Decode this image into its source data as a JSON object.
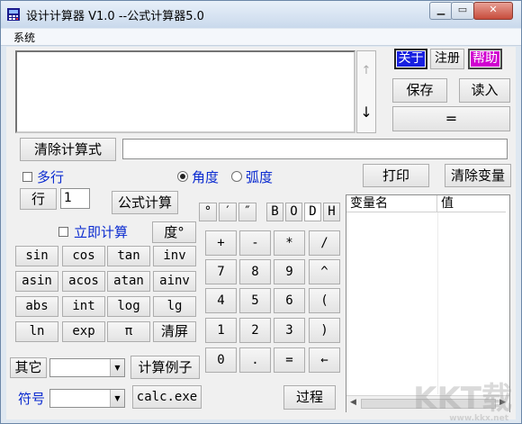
{
  "window": {
    "title": "设计计算器 V1.0 --公式计算器5.0",
    "minimize_icon": "minimize-icon",
    "maximize_icon": "maximize-icon",
    "close_icon": "close-icon"
  },
  "menu": {
    "system": "系统"
  },
  "right_top": {
    "about": "关于",
    "register": "注册",
    "help": "帮助",
    "save": "保存",
    "read": "读入",
    "equals": "=",
    "about_color": "#1820e0",
    "help_color": "#d000d0"
  },
  "formula_bar": {
    "clear_formula": "清除计算式",
    "result_value": ""
  },
  "options": {
    "multiline": "多行",
    "degree": "角度",
    "radian": "弧度",
    "print": "打印",
    "clear_vars": "清除变量",
    "row_label": "行",
    "row_value": "1",
    "formula_calc": "公式计算",
    "instant_calc": "立即计算",
    "degree_symbol_btn": "度°"
  },
  "symbols": {
    "deg": "°",
    "min": "′",
    "sec": "″",
    "b": "B",
    "o": "O",
    "d": "D",
    "h": "H"
  },
  "functions": {
    "sin": "sin",
    "cos": "cos",
    "tan": "tan",
    "inv": "inv",
    "asin": "asin",
    "acos": "acos",
    "atan": "atan",
    "ainv": "ainv",
    "abs": "abs",
    "int": "int",
    "log": "log",
    "lg": "lg",
    "ln": "ln",
    "exp": "exp",
    "pi": "π",
    "clear_screen": "清屏"
  },
  "keypad": {
    "plus": "+",
    "minus": "-",
    "mul": "*",
    "div": "/",
    "k7": "7",
    "k8": "8",
    "k9": "9",
    "pow": "^",
    "k4": "4",
    "k5": "5",
    "k6": "6",
    "lparen": "(",
    "k1": "1",
    "k2": "2",
    "k3": "3",
    "rparen": ")",
    "k0": "0",
    "dot": ".",
    "eq": "=",
    "back": "←"
  },
  "bottom": {
    "other_label": "其它",
    "other_value": "",
    "examples": "计算例子",
    "symbol_label": "符号",
    "symbol_value": "",
    "calc_exe": "calc.exe",
    "process": "过程"
  },
  "variables": {
    "col_name": "变量名",
    "col_value": "值"
  },
  "watermark": {
    "text": "KKT载",
    "url": "www.kkx.net"
  }
}
